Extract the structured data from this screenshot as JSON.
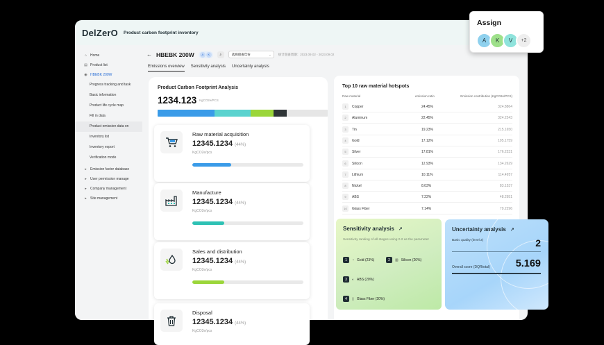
{
  "app": {
    "logo": "DelZerO",
    "title": "Product carbon footprint inventory"
  },
  "sidebar": {
    "items": [
      {
        "label": "Home",
        "icon": "home-icon"
      },
      {
        "label": "Product list",
        "icon": "list-icon"
      },
      {
        "label": "HBEBK 200W",
        "icon": "product-icon"
      }
    ],
    "sub_items": [
      "Progress tracking and task",
      "Basic information",
      "Product life cycle map",
      "Fill in data",
      "Product emission data on",
      "Inventory list",
      "Inventory export",
      "Verification mode"
    ],
    "lower_items": [
      {
        "label": "Emission factor database",
        "icon": "database-icon"
      },
      {
        "label": "User permission manage",
        "icon": "users-icon"
      },
      {
        "label": "Company management",
        "icon": "building-icon"
      },
      {
        "label": "Site management",
        "icon": "site-icon"
      }
    ]
  },
  "header": {
    "product": "HBEBK 200W",
    "chips": [
      "A",
      "K"
    ],
    "select_value": "选择盘查年份",
    "period": "统计盘查周期：2023.09.02 - 2023.09.02"
  },
  "tabs": [
    "Emissions overview",
    "Sensitivity analysis",
    "Uncertainty analysis"
  ],
  "overview": {
    "title": "Product Carbon Footprint Analysis",
    "total": "1234.123",
    "unit": "KgCO2e/PCS",
    "stack": [
      {
        "value": 38,
        "color": "#3a9be8"
      },
      {
        "value": 24,
        "color": "#5bd3cf"
      },
      {
        "value": 15,
        "color": "#9bd63a"
      },
      {
        "value": 9,
        "color": "#2f3537"
      },
      {
        "value": 27,
        "color": "#e6e6e6"
      }
    ]
  },
  "stages": [
    {
      "name": "Raw material acquisition",
      "value": "12345.1234",
      "percent": "(44%)",
      "unit": "KgCO2e/pcs",
      "fill": 0.35,
      "color": "#3a9be8",
      "icon": "cart-icon"
    },
    {
      "name": "Manufacture",
      "value": "12345.1234",
      "percent": "(44%)",
      "unit": "KgCO2e/pcs",
      "fill": 0.29,
      "color": "#2ec1b4",
      "icon": "factory-icon"
    },
    {
      "name": "Sales and distribution",
      "value": "12345.1234",
      "percent": "(44%)",
      "unit": "KgCO2e/pcs",
      "fill": 0.29,
      "color": "#9bd63a",
      "icon": "hand-drop-icon"
    },
    {
      "name": "Disposal",
      "value": "12345.1234",
      "percent": "(44%)",
      "unit": "KgCO2e/pcs",
      "fill": 0.0,
      "color": "#2f3537",
      "icon": "trash-icon"
    }
  ],
  "hotspots": {
    "title": "Top 10 raw material hotspots",
    "headers": [
      "Raw material",
      "emission ratio",
      "Emission contribution (KgCO2e/PCS)"
    ],
    "rows": [
      {
        "rank": "1",
        "material": "Copper",
        "ratio": "24.45%",
        "contribution": "324.8864"
      },
      {
        "rank": "2",
        "material": "Aluminum",
        "ratio": "22.45%",
        "contribution": "324.2243"
      },
      {
        "rank": "3",
        "material": "Tin",
        "ratio": "19.23%",
        "contribution": "215.1650"
      },
      {
        "rank": "4",
        "material": "Gold",
        "ratio": "17.12%",
        "contribution": "195.1759"
      },
      {
        "rank": "5",
        "material": "Silver",
        "ratio": "17.81%",
        "contribution": "176.2231"
      },
      {
        "rank": "6",
        "material": "Silicon",
        "ratio": "12.93%",
        "contribution": "134.2629"
      },
      {
        "rank": "7",
        "material": "Lithium",
        "ratio": "10.11%",
        "contribution": "114.4957"
      },
      {
        "rank": "8",
        "material": "Nickel",
        "ratio": "8.03%",
        "contribution": "83.1537"
      },
      {
        "rank": "9",
        "material": "ABS",
        "ratio": "7.22%",
        "contribution": "48.2951"
      },
      {
        "rank": "10",
        "material": "Glass Fiber",
        "ratio": "7.14%",
        "contribution": "79.2296"
      }
    ]
  },
  "sensitivity": {
    "title": "Sensitivity analysis",
    "description": "Sensitivity ranking of all stages using 0.2 as the parameter",
    "items": [
      {
        "rank": "1",
        "label": "Gold (23%)"
      },
      {
        "rank": "2",
        "label": "Silicon (20%)"
      },
      {
        "rank": "3",
        "label": "ABS (20%)"
      },
      {
        "rank": "4",
        "label": "Glass Fiber (20%)"
      }
    ]
  },
  "uncertainty": {
    "title": "Uncertainty analysis",
    "basic_label": "Basic quality (level 2)",
    "basic_value": "2",
    "overall_label": "Overall score (DQRtotal)",
    "overall_value": "5.169"
  },
  "assign": {
    "title": "Assign",
    "avatars": [
      {
        "letter": "A",
        "color": "#8fd1ee"
      },
      {
        "letter": "K",
        "color": "#9ee08a"
      },
      {
        "letter": "V",
        "color": "#8fe3dc"
      }
    ],
    "more": "+2"
  }
}
